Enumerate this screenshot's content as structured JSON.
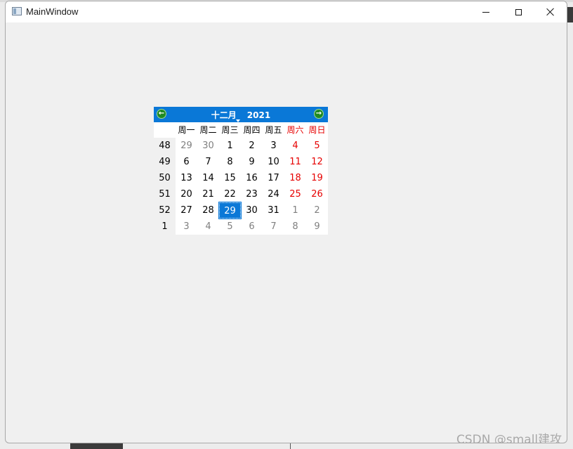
{
  "window": {
    "title": "MainWindow",
    "controls": [
      "minimize-icon",
      "maximize-icon",
      "close-icon"
    ]
  },
  "calendar": {
    "nav": {
      "prev_icon": "arrow-left-icon",
      "next_icon": "arrow-right-icon",
      "month": "十二月",
      "year": "2021"
    },
    "day_headers": [
      "周一",
      "周二",
      "周三",
      "周四",
      "周五",
      "周六",
      "周日"
    ],
    "weeks": [
      {
        "week": "48",
        "days": [
          "29",
          "30",
          "1",
          "2",
          "3",
          "4",
          "5"
        ]
      },
      {
        "week": "49",
        "days": [
          "6",
          "7",
          "8",
          "9",
          "10",
          "11",
          "12"
        ]
      },
      {
        "week": "50",
        "days": [
          "13",
          "14",
          "15",
          "16",
          "17",
          "18",
          "19"
        ]
      },
      {
        "week": "51",
        "days": [
          "20",
          "21",
          "22",
          "23",
          "24",
          "25",
          "26"
        ]
      },
      {
        "week": "52",
        "days": [
          "27",
          "28",
          "29",
          "30",
          "31",
          "1",
          "2"
        ]
      },
      {
        "week": "1",
        "days": [
          "3",
          "4",
          "5",
          "6",
          "7",
          "8",
          "9"
        ]
      }
    ],
    "selected_day": "29",
    "colors": {
      "nav_background": "#0a78d7",
      "selected_background": "#0a78d7",
      "weekend_text": "#e60000",
      "other_month_text": "#808080"
    }
  },
  "watermark": "CSDN @small建攻"
}
